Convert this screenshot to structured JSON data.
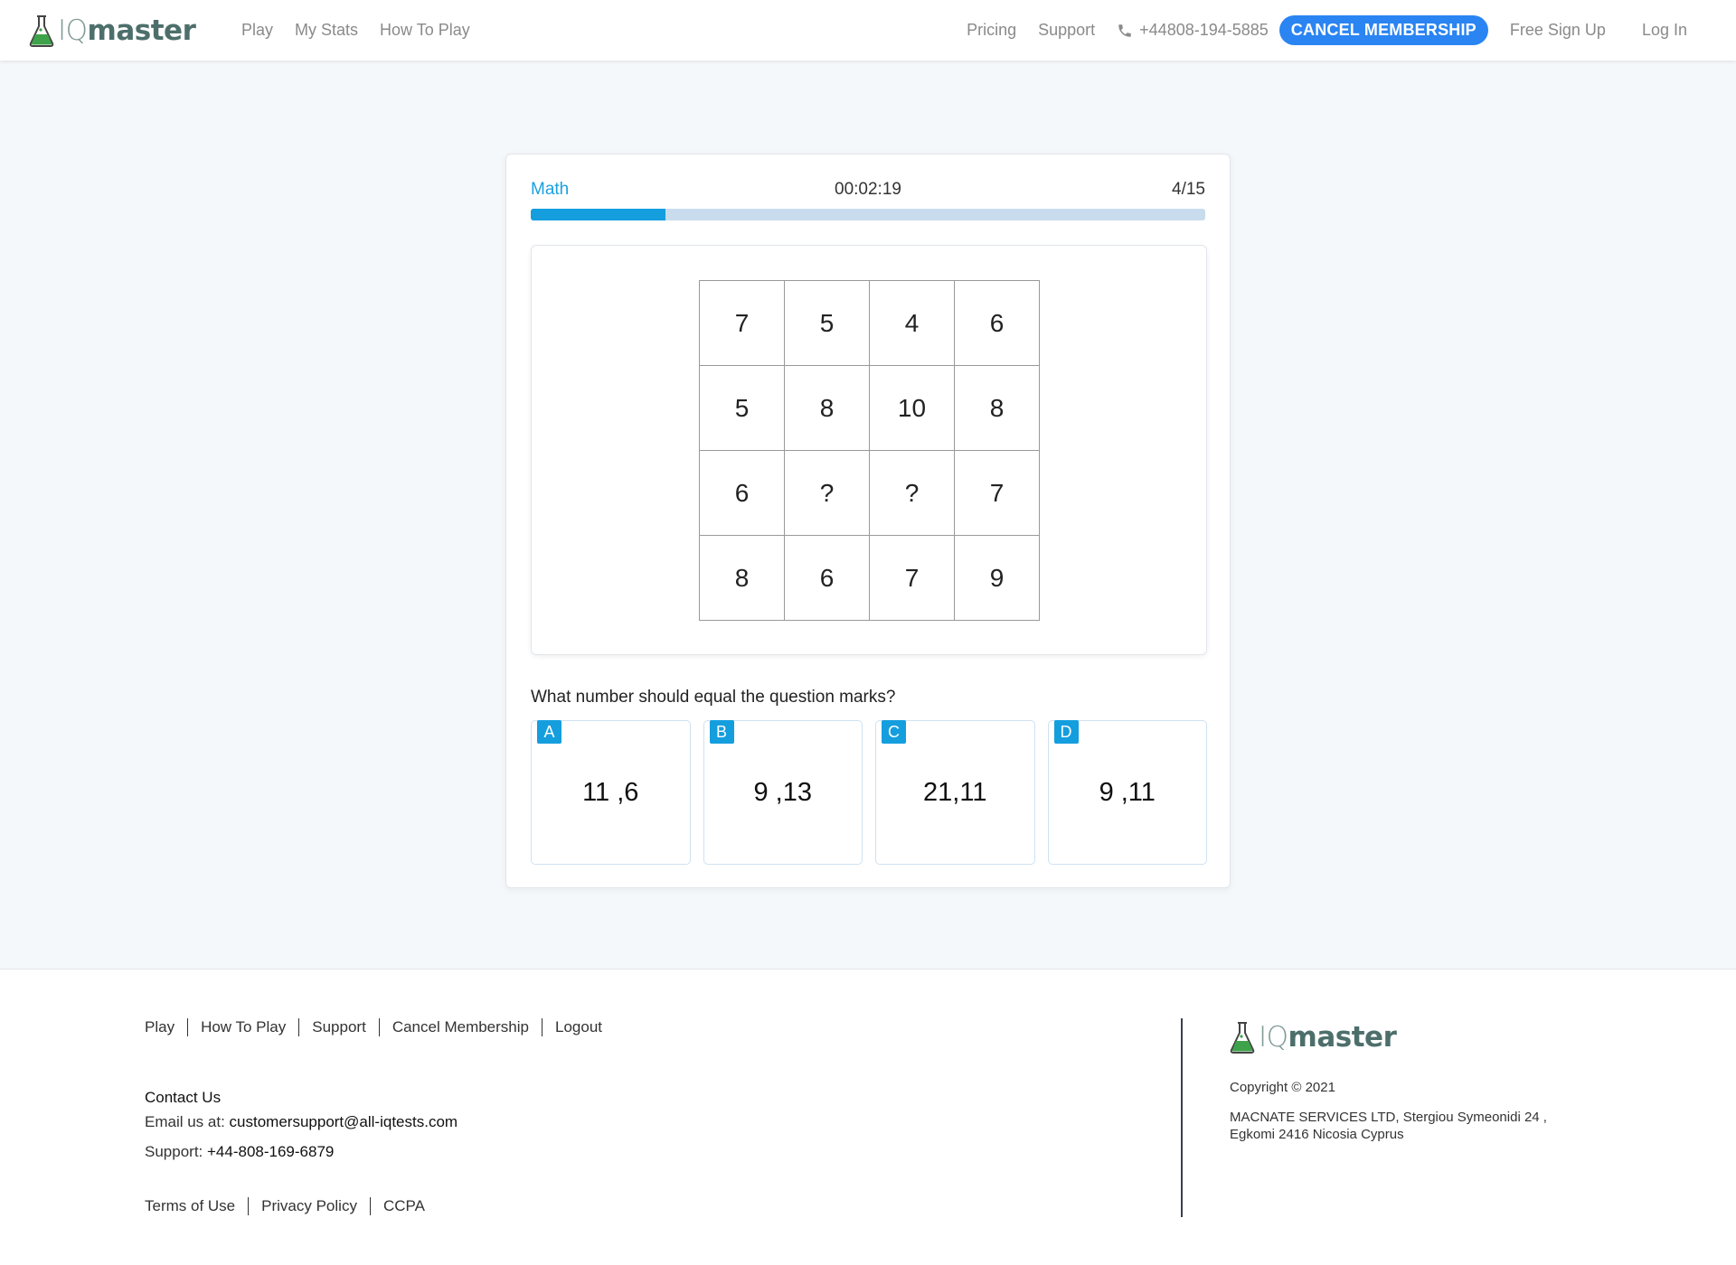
{
  "header": {
    "logo": {
      "prefix": "IQ",
      "suffix": "master"
    },
    "nav_left": [
      "Play",
      "My Stats",
      "How To Play"
    ],
    "pricing": "Pricing",
    "support": "Support",
    "phone": "+44808-194-5885",
    "cancel_membership": "CANCEL MEMBERSHIP",
    "free_signup": "Free Sign Up",
    "login": "Log In"
  },
  "quiz": {
    "category": "Math",
    "timer": "00:02:19",
    "progress_text": "4/15",
    "progress_fraction": 0.2,
    "grid": [
      [
        "7",
        "5",
        "4",
        "6"
      ],
      [
        "5",
        "8",
        "10",
        "8"
      ],
      [
        "6",
        "?",
        "?",
        "7"
      ],
      [
        "8",
        "6",
        "7",
        "9"
      ]
    ],
    "question": "What number should equal the question marks?",
    "answers": [
      {
        "letter": "A",
        "value": "11 ,6"
      },
      {
        "letter": "B",
        "value": "9 ,13"
      },
      {
        "letter": "C",
        "value": "21,11"
      },
      {
        "letter": "D",
        "value": "9 ,11"
      }
    ]
  },
  "footer": {
    "links": [
      "Play",
      "How To Play",
      "Support",
      "Cancel Membership",
      "Logout"
    ],
    "contact_title": "Contact Us",
    "email_label": "Email us at: ",
    "email": "customersupport@all-iqtests.com",
    "support_label": "Support: ",
    "support_phone": "+44-808-169-6879",
    "legal": [
      "Terms of Use",
      "Privacy Policy",
      "CCPA"
    ],
    "copyright": "Copyright © 2021",
    "company_line1": "MACNATE SERVICES LTD, Stergiou Symeonidi 24 ,",
    "company_line2": "Egkomi 2416 Nicosia Cyprus"
  },
  "colors": {
    "accent": "#149ede",
    "cancel_button": "#2a84f2",
    "progress_track": "#c8dced",
    "logo_green": "#3ea24a"
  },
  "icons": [
    "flask-icon",
    "phone-icon"
  ]
}
